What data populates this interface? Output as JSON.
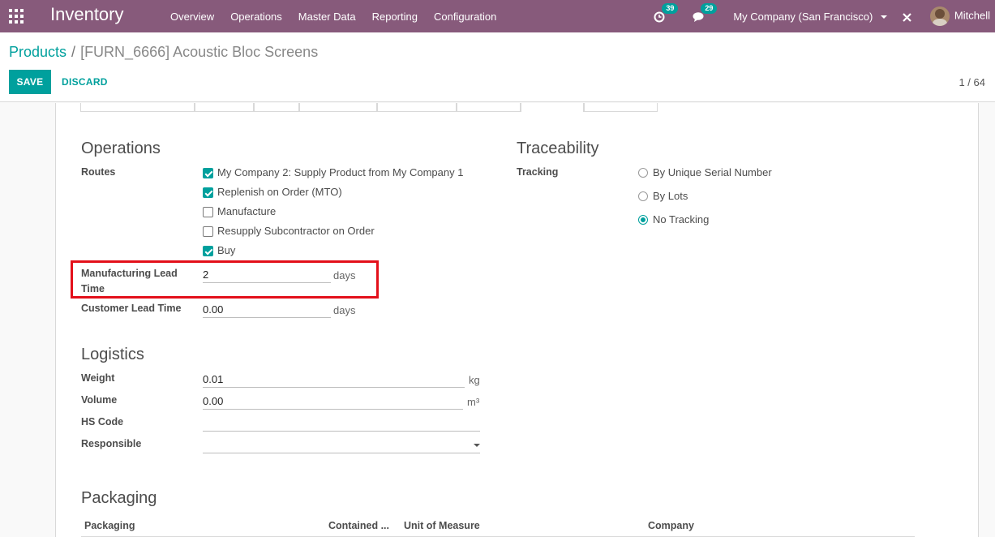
{
  "navbar": {
    "app_name": "Inventory",
    "menu": [
      "Overview",
      "Operations",
      "Master Data",
      "Reporting",
      "Configuration"
    ],
    "activity_count": "39",
    "messages_count": "29",
    "company": "My Company (San Francisco)",
    "user": "Mitchell"
  },
  "breadcrumb": {
    "parent": "Products",
    "separator": "/",
    "current": "[FURN_6666] Acoustic Bloc Screens"
  },
  "actions": {
    "save": "SAVE",
    "discard": "DISCARD"
  },
  "pager": "1 / 64",
  "operations": {
    "title": "Operations",
    "routes_label": "Routes",
    "routes": [
      {
        "label": "My Company 2: Supply Product from My Company 1",
        "checked": true
      },
      {
        "label": "Replenish on Order (MTO)",
        "checked": true
      },
      {
        "label": "Manufacture",
        "checked": false
      },
      {
        "label": "Resupply Subcontractor on Order",
        "checked": false
      },
      {
        "label": "Buy",
        "checked": true
      }
    ],
    "mfg_lead_label_1": "Manufacturing Lead",
    "mfg_lead_label_2": "Time",
    "mfg_lead_value": "2",
    "mfg_lead_unit": "days",
    "customer_lead_label": "Customer Lead Time",
    "customer_lead_value": "0.00",
    "customer_lead_unit": "days"
  },
  "traceability": {
    "title": "Traceability",
    "tracking_label": "Tracking",
    "options": [
      {
        "label": "By Unique Serial Number",
        "checked": false
      },
      {
        "label": "By Lots",
        "checked": false
      },
      {
        "label": "No Tracking",
        "checked": true
      }
    ]
  },
  "logistics": {
    "title": "Logistics",
    "weight_label": "Weight",
    "weight_value": "0.01",
    "weight_unit": "kg",
    "volume_label": "Volume",
    "volume_value": "0.00",
    "volume_unit": "m³",
    "hs_code_label": "HS Code",
    "hs_code_value": "",
    "responsible_label": "Responsible",
    "responsible_value": ""
  },
  "packaging": {
    "title": "Packaging",
    "columns": [
      "Packaging",
      "Contained ...",
      "Unit of Measure",
      "Company"
    ]
  },
  "colors": {
    "navbar": "#875a7b",
    "accent": "#00a09d",
    "highlight": "#e3101a"
  }
}
